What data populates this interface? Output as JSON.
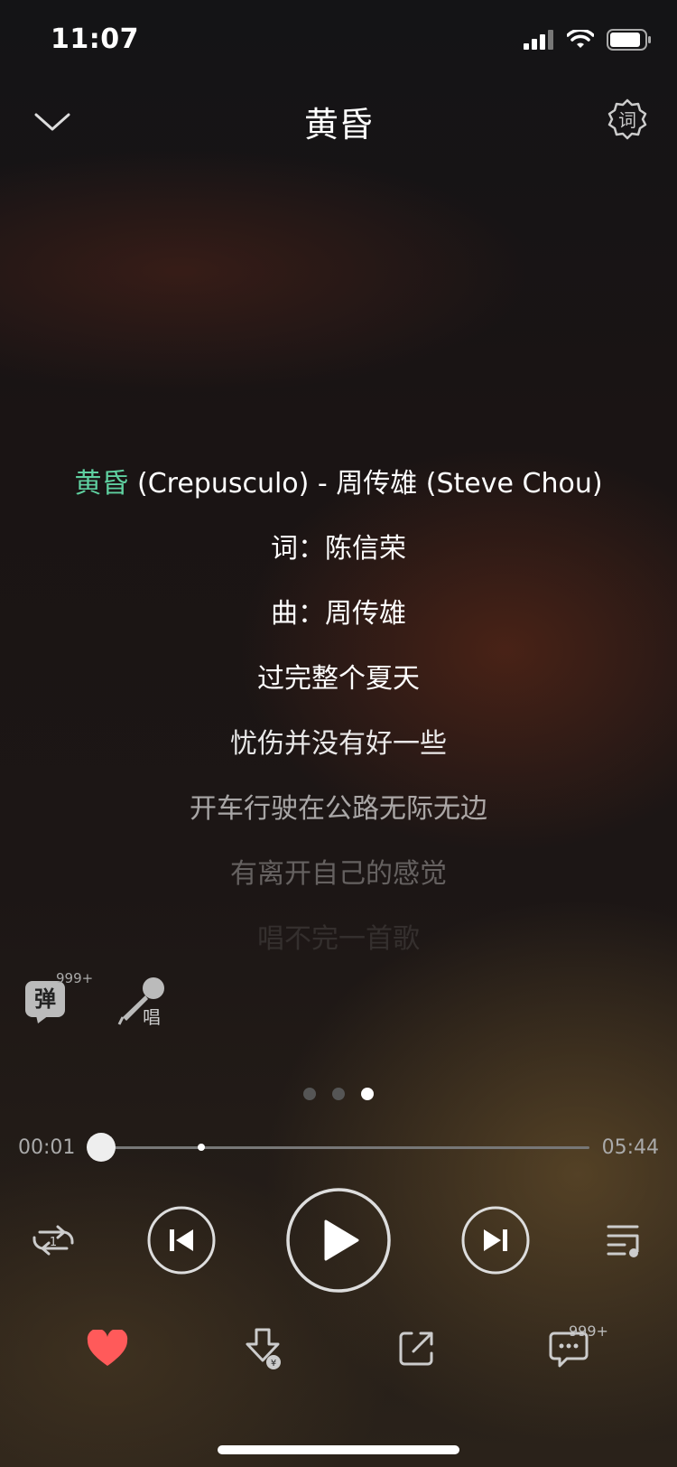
{
  "status_bar": {
    "time": "11:07"
  },
  "header": {
    "title": "黄昏",
    "settings_icon_text": "词"
  },
  "lyrics": [
    {
      "highlight": "黄昏",
      "text": " (Crepusculo) - 周传雄 (Steve Chou)",
      "opacity": 1.0
    },
    {
      "highlight": "",
      "text": "词：陈信荣",
      "opacity": 1.0
    },
    {
      "highlight": "",
      "text": "曲：周传雄",
      "opacity": 1.0
    },
    {
      "highlight": "",
      "text": "过完整个夏天",
      "opacity": 1.0
    },
    {
      "highlight": "",
      "text": "忧伤并没有好一些",
      "opacity": 0.9
    },
    {
      "highlight": "",
      "text": "开车行驶在公路无际无边",
      "opacity": 0.62
    },
    {
      "highlight": "",
      "text": "有离开自己的感觉",
      "opacity": 0.32
    },
    {
      "highlight": "",
      "text": "唱不完一首歌",
      "opacity": 0.1
    }
  ],
  "side_tools": {
    "danmaku_label": "弹",
    "danmaku_count": "999+",
    "karaoke_label": "唱"
  },
  "pager": {
    "count": 3,
    "active": 2
  },
  "progress": {
    "current": "00:01",
    "total": "05:44"
  },
  "bottom_bar": {
    "comment_count": "999+"
  },
  "colors": {
    "accent": "#5fd0a0",
    "like": "#ff5a5a"
  }
}
